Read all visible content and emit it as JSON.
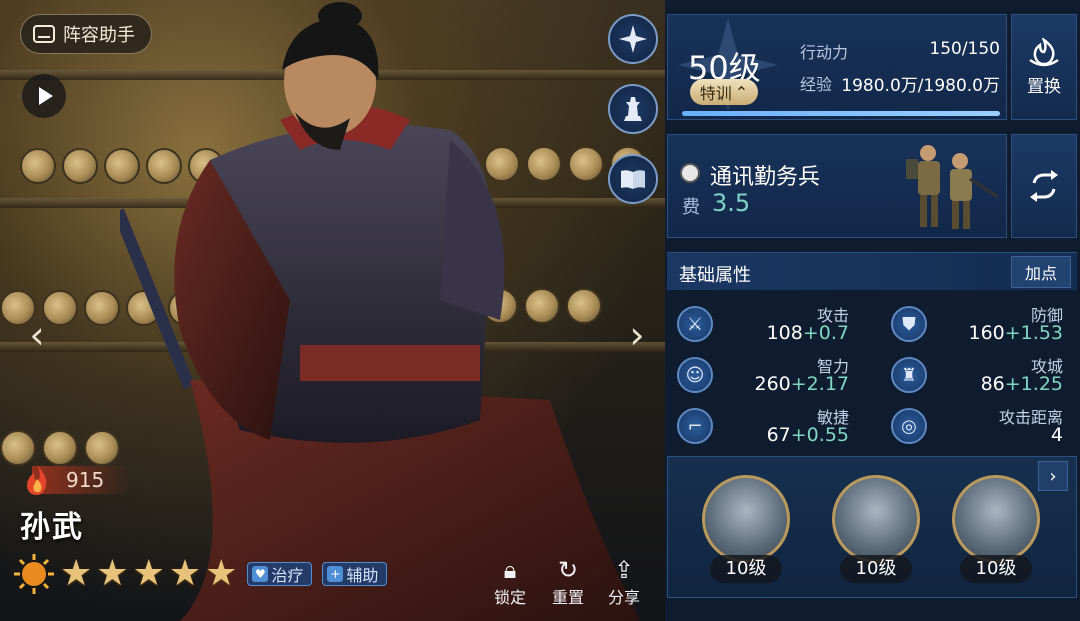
{
  "lineup_helper": "阵容助手",
  "hero": {
    "power": "915",
    "name": "孙武",
    "stars": 5,
    "roles": [
      "治疗",
      "辅助"
    ]
  },
  "actions": {
    "lock": "锁定",
    "reset": "重置",
    "share": "分享"
  },
  "level": {
    "label": "50级",
    "train": "特训",
    "action_power_label": "行动力",
    "action_power_value": "150/150",
    "exp_label": "经验",
    "exp_value": "1980.0万/1980.0万",
    "exp_fraction": 1.0
  },
  "swap_label": "置换",
  "troop": {
    "name": "通讯勤务兵",
    "cost_label": "费",
    "cost_value": "3.5"
  },
  "attributes": {
    "title": "基础属性",
    "add_points": "加点",
    "items": [
      {
        "name": "攻击",
        "base": "108",
        "bonus": "+0.7",
        "icon": "sword-icon"
      },
      {
        "name": "防御",
        "base": "160",
        "bonus": "+1.53",
        "icon": "shield-icon"
      },
      {
        "name": "智力",
        "base": "260",
        "bonus": "+2.17",
        "icon": "brain-head-icon"
      },
      {
        "name": "攻城",
        "base": "86",
        "bonus": "+1.25",
        "icon": "castle-icon"
      },
      {
        "name": "敏捷",
        "base": "67",
        "bonus": "+0.55",
        "icon": "boot-icon"
      },
      {
        "name": "攻击距离",
        "base": "4",
        "bonus": "",
        "icon": "range-icon"
      }
    ]
  },
  "skills": [
    {
      "level": "10级"
    },
    {
      "level": "10级"
    },
    {
      "level": "10级"
    }
  ],
  "colors": {
    "panel_bg": "#0f1c30",
    "card_blue": "#183258",
    "bonus_teal": "#7fd6c4",
    "star_gold": "#e6c27a",
    "power_red": "#a0321e"
  }
}
